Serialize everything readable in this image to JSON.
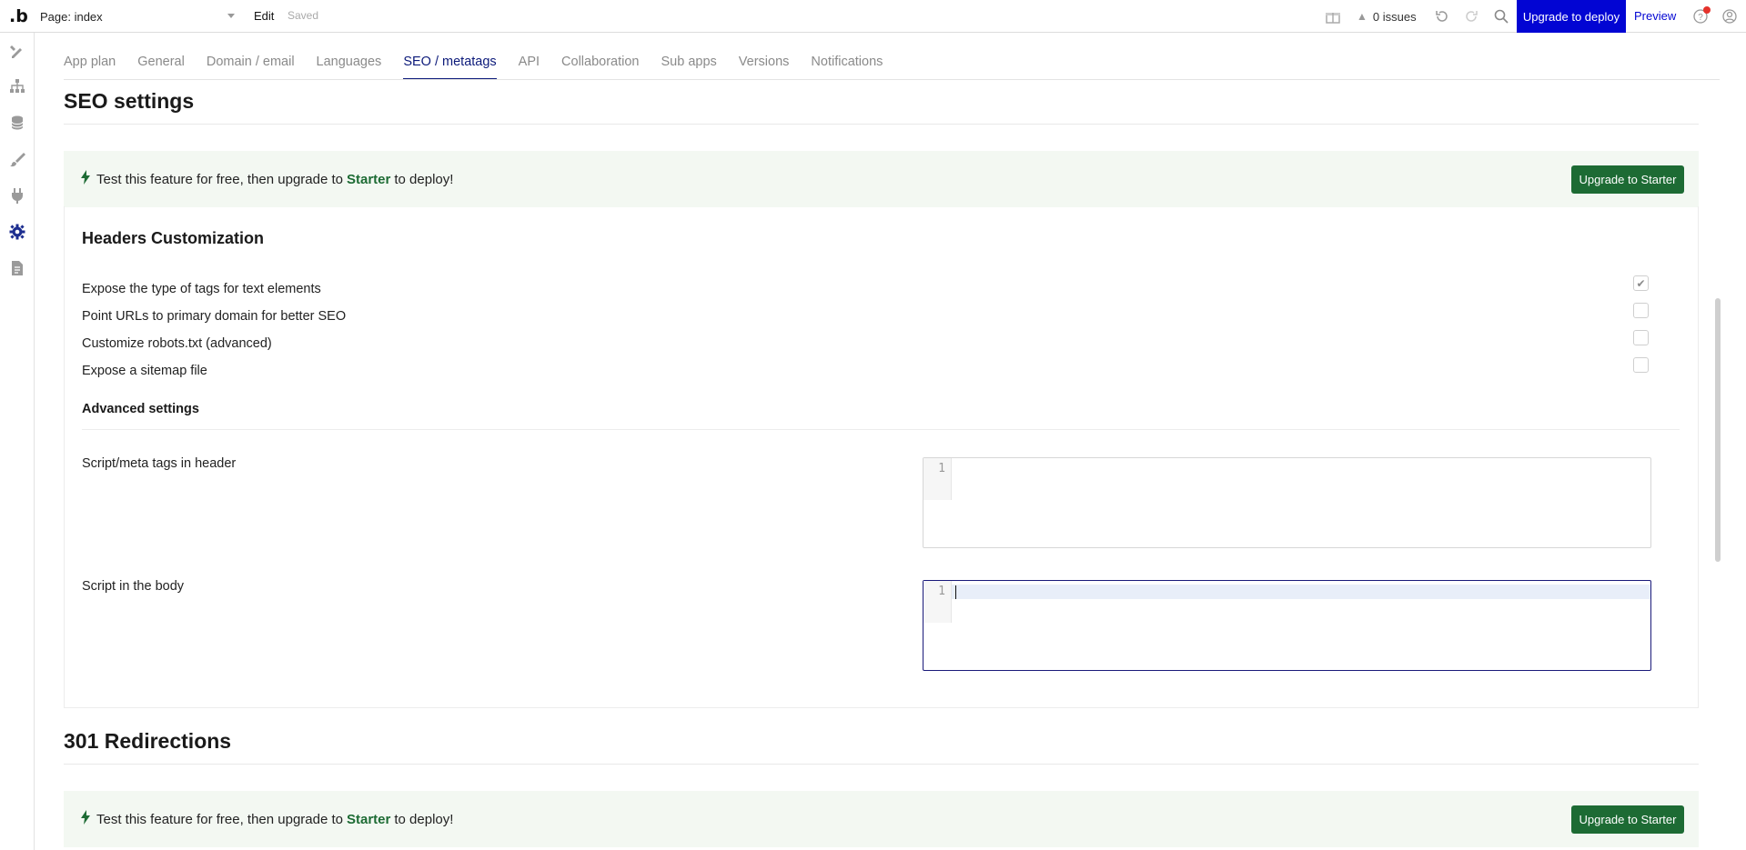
{
  "topbar": {
    "logo": ".b",
    "page_select": "Page: index",
    "edit": "Edit",
    "saved": "Saved",
    "issues": "0 issues",
    "upgrade_deploy": "Upgrade to deploy",
    "preview": "Preview"
  },
  "tabs": [
    {
      "label": "App plan"
    },
    {
      "label": "General"
    },
    {
      "label": "Domain / email"
    },
    {
      "label": "Languages"
    },
    {
      "label": "SEO / metatags",
      "active": true
    },
    {
      "label": "API"
    },
    {
      "label": "Collaboration"
    },
    {
      "label": "Sub apps"
    },
    {
      "label": "Versions"
    },
    {
      "label": "Notifications"
    }
  ],
  "seo": {
    "title": "SEO settings",
    "banner_pre": "Test this feature for free, then upgrade to",
    "banner_plan": "Starter",
    "banner_post": "to deploy!",
    "upgrade_button": "Upgrade to Starter",
    "headers_title": "Headers Customization",
    "options": [
      {
        "label": "Expose the type of tags for text elements",
        "checked": true
      },
      {
        "label": "Point URLs to primary domain for better SEO",
        "checked": false
      },
      {
        "label": "Customize robots.txt (advanced)",
        "checked": false
      },
      {
        "label": "Expose a sitemap file",
        "checked": false
      }
    ],
    "advanced_title": "Advanced settings",
    "header_script_label": "Script/meta tags in header",
    "body_script_label": "Script in the body",
    "line_number": "1"
  },
  "redirections": {
    "title": "301 Redirections",
    "banner_pre": "Test this feature for free, then upgrade to",
    "banner_plan": "Starter",
    "banner_post": "to deploy!",
    "upgrade_button": "Upgrade to Starter"
  },
  "colors": {
    "accent_blue": "#0205d3",
    "green": "#1d6b34",
    "banner_bg": "#f3f8f2"
  }
}
